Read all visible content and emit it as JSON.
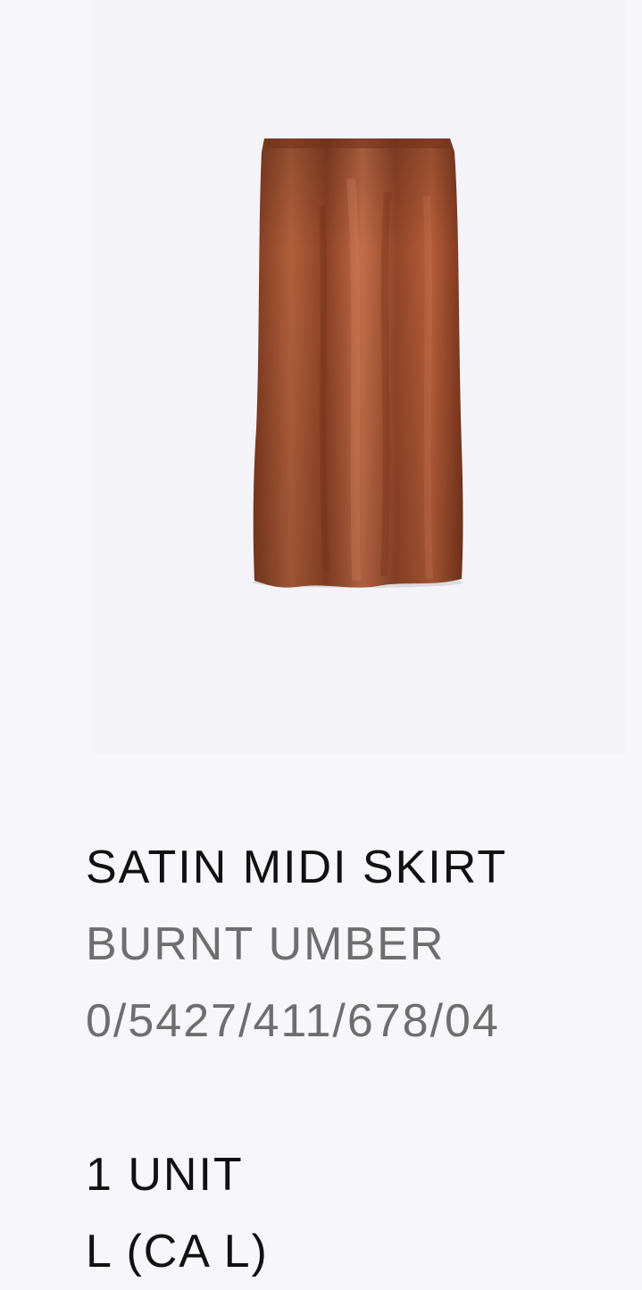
{
  "product": {
    "image_icon": "skirt-image",
    "name": "SATIN MIDI SKIRT",
    "color_name": "BURNT UMBER",
    "reference": "0/5427/411/678/04",
    "quantity": "1 UNIT",
    "size": "L (CA L)"
  },
  "colors": {
    "background": "#f7f6fb",
    "image_panel": "#f4f3f8",
    "skirt": "#a4502f",
    "primary_text": "#111111",
    "secondary_text": "#6e6e6e"
  }
}
